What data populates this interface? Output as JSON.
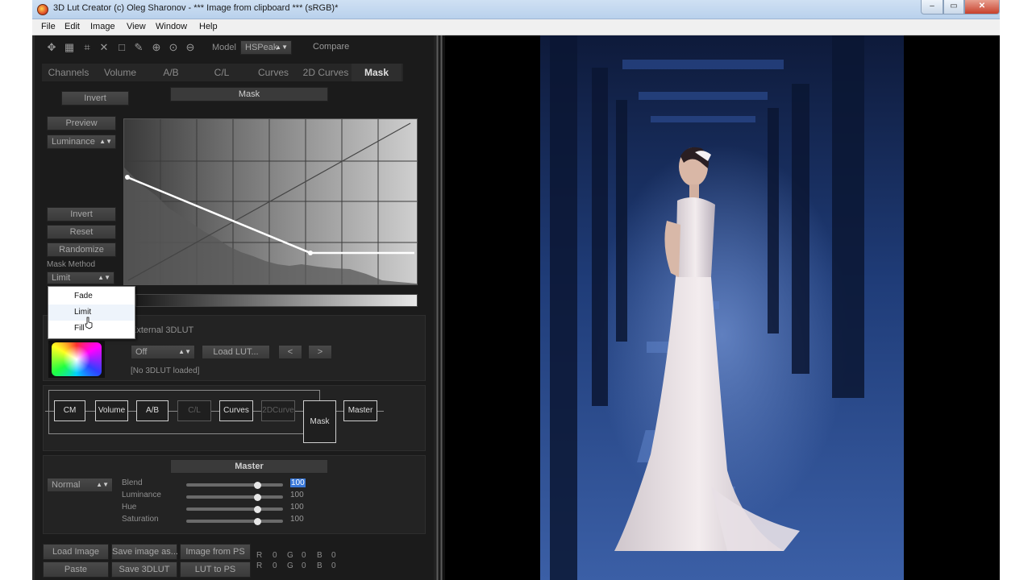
{
  "window": {
    "title": "3D Lut Creator (c) Oleg Sharonov - *** Image from clipboard *** (sRGB)*",
    "minimize_label": "–",
    "maximize_label": "▭",
    "close_label": "✕"
  },
  "menu": [
    "File",
    "Edit",
    "Image",
    "View",
    "Window",
    "Help"
  ],
  "toolbar": {
    "model_label": "Model",
    "model_value": "HSPeak",
    "compare_label": "Compare"
  },
  "tabs": [
    "Channels",
    "Volume",
    "A/B",
    "C/L",
    "Curves",
    "2D Curves",
    "Mask"
  ],
  "active_tab": "Mask",
  "mask": {
    "invert_top_label": "Invert",
    "header": "Mask",
    "preview_label": "Preview",
    "channel_select": "Luminance",
    "invert_label": "Invert",
    "reset_label": "Reset",
    "randomize_label": "Randomize",
    "method_label": "Mask Method",
    "method_value": "Limit",
    "method_options": [
      "Fade",
      "Limit",
      "Fill"
    ],
    "method_selected": "Limit"
  },
  "external_lut": {
    "label": "External 3DLUT",
    "mode_value": "Off",
    "load_label": "Load LUT...",
    "prev_label": "<",
    "next_label": ">",
    "status": "[No 3DLUT loaded]"
  },
  "pipeline": {
    "nodes": [
      "CM",
      "Volume",
      "A/B",
      "C/L",
      "Curves",
      "2DCurve",
      "Mask",
      "Master"
    ],
    "disabled": [
      "C/L",
      "2DCurve"
    ]
  },
  "master": {
    "header": "Master",
    "blend_mode": "Normal",
    "sliders": [
      {
        "name": "Blend",
        "value": "100",
        "level": 0.73
      },
      {
        "name": "Luminance",
        "value": "100",
        "level": 0.73
      },
      {
        "name": "Hue",
        "value": "100",
        "level": 0.73
      },
      {
        "name": "Saturation",
        "value": "100",
        "level": 0.73
      }
    ]
  },
  "bottom_buttons": {
    "load_image": "Load Image",
    "save_image": "Save image as...",
    "image_from_ps": "Image from PS",
    "paste": "Paste",
    "save_3dlut": "Save 3DLUT",
    "lut_to_ps": "LUT to PS"
  },
  "rgb_readout": {
    "row1": [
      "R",
      "0",
      "G",
      "0",
      "B",
      "0"
    ],
    "row2": [
      "R",
      "0",
      "G",
      "0",
      "B",
      "0"
    ]
  },
  "colors": {
    "panel_bg": "#1b1b1b",
    "accent_highlight": "#3a78d8",
    "photo_blue": "#2c4f8f"
  }
}
